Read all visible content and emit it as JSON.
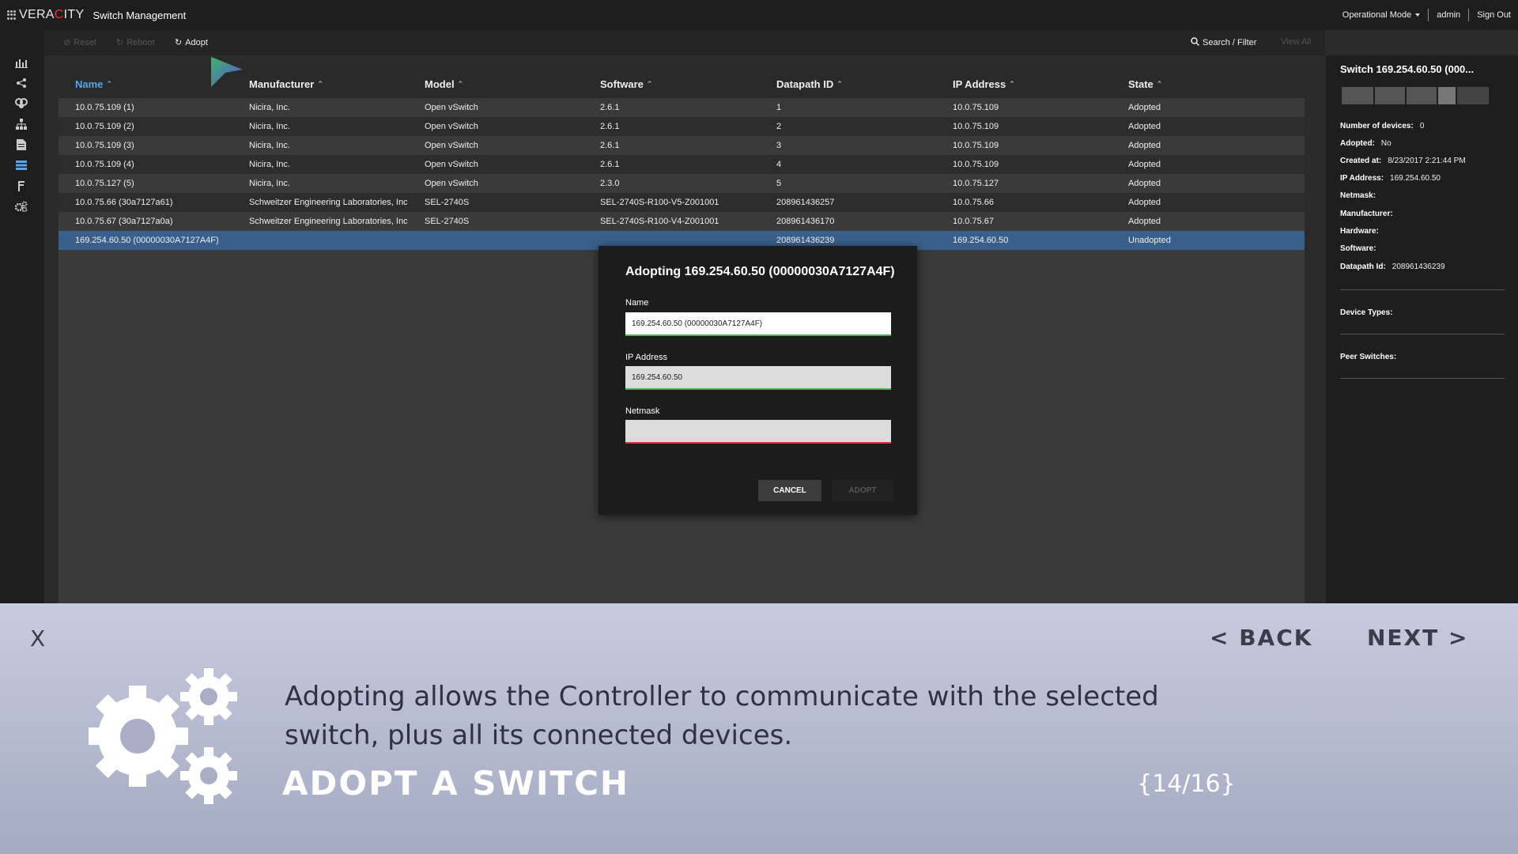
{
  "header": {
    "logo_prefix": "VERA",
    "logo_accent": "C",
    "logo_suffix": "ITY",
    "app_title": "Switch Management",
    "mode": "Operational Mode",
    "user": "admin",
    "sign_out": "Sign Out"
  },
  "sidebar": {
    "icons": [
      "chart-icon",
      "share-icon",
      "devices-icon",
      "topology-icon",
      "document-icon",
      "switch-list-icon",
      "flow-icon",
      "settings-icon"
    ]
  },
  "toolbar": {
    "reset": "Reset",
    "reboot": "Reboot",
    "adopt": "Adopt",
    "search": "Search / Filter",
    "view_all": "View All"
  },
  "table": {
    "columns": [
      "Name",
      "Manufacturer",
      "Model",
      "Software",
      "Datapath ID",
      "IP Address",
      "State"
    ],
    "rows": [
      [
        "10.0.75.109 (1)",
        "Nicira, Inc.",
        "Open vSwitch",
        "2.6.1",
        "1",
        "10.0.75.109",
        "Adopted"
      ],
      [
        "10.0.75.109 (2)",
        "Nicira, Inc.",
        "Open vSwitch",
        "2.6.1",
        "2",
        "10.0.75.109",
        "Adopted"
      ],
      [
        "10.0.75.109 (3)",
        "Nicira, Inc.",
        "Open vSwitch",
        "2.6.1",
        "3",
        "10.0.75.109",
        "Adopted"
      ],
      [
        "10.0.75.109 (4)",
        "Nicira, Inc.",
        "Open vSwitch",
        "2.6.1",
        "4",
        "10.0.75.109",
        "Adopted"
      ],
      [
        "10.0.75.127 (5)",
        "Nicira, Inc.",
        "Open vSwitch",
        "2.3.0",
        "5",
        "10.0.75.127",
        "Adopted"
      ],
      [
        "10.0.75.66 (30a7127a61)",
        "Schweitzer Engineering Laboratories, Inc",
        "SEL-2740S",
        "SEL-2740S-R100-V5-Z001001",
        "208961436257",
        "10.0.75.66",
        "Adopted"
      ],
      [
        "10.0.75.67 (30a7127a0a)",
        "Schweitzer Engineering Laboratories, Inc",
        "SEL-2740S",
        "SEL-2740S-R100-V4-Z001001",
        "208961436170",
        "10.0.75.67",
        "Adopted"
      ],
      [
        "169.254.60.50 (00000030A7127A4F)",
        "",
        "",
        "",
        "208961436239",
        "169.254.60.50",
        "Unadopted"
      ]
    ]
  },
  "dialog": {
    "title": "Adopting 169.254.60.50 (00000030A7127A4F)",
    "name_label": "Name",
    "name_value": "169.254.60.50 (00000030A7127A4F)",
    "ip_label": "IP Address",
    "ip_value": "169.254.60.50",
    "netmask_label": "Netmask",
    "netmask_value": "",
    "cancel": "CANCEL",
    "adopt": "ADOPT"
  },
  "details": {
    "title": "Switch 169.254.60.50 (000...",
    "fields": [
      {
        "label": "Number of devices:",
        "value": "0"
      },
      {
        "label": "Adopted:",
        "value": "No"
      },
      {
        "label": "Created at:",
        "value": "8/23/2017 2:21:44 PM"
      },
      {
        "label": "IP Address:",
        "value": "169.254.60.50"
      },
      {
        "label": "Netmask:",
        "value": ""
      },
      {
        "label": "Manufacturer:",
        "value": ""
      },
      {
        "label": "Hardware:",
        "value": ""
      },
      {
        "label": "Software:",
        "value": ""
      },
      {
        "label": "Datapath Id:",
        "value": "208961436239"
      }
    ],
    "device_types": "Device Types:",
    "peer_switches": "Peer Switches:"
  },
  "tour": {
    "close": "X",
    "back": "< BACK",
    "next": "NEXT >",
    "text": "Adopting allows the Controller to communicate with the selected switch, plus all its connected devices.",
    "heading": "ADOPT A SWITCH",
    "step": "{14/16}"
  },
  "colors": {
    "selected_row": "#3a5f8a",
    "active_header": "#5aa6e8",
    "valid_underline": "#4caf50",
    "invalid_underline": "#d33333"
  }
}
